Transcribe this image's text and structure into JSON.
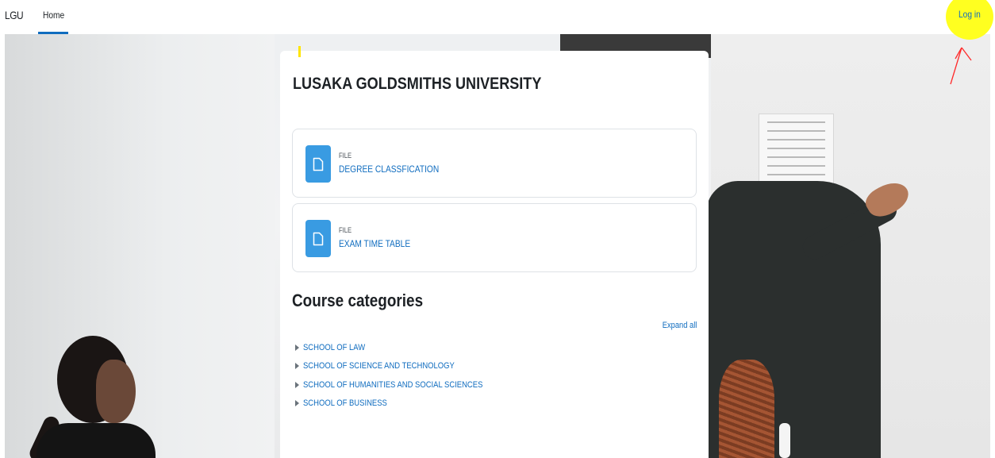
{
  "navbar": {
    "brand": "LGU",
    "home_label": "Home",
    "login_label": "Log in"
  },
  "site": {
    "title": "LUSAKA GOLDSMITHS UNIVERSITY"
  },
  "activities": [
    {
      "type": "FILE",
      "name": "DEGREE CLASSFICATION",
      "icon": "file-icon"
    },
    {
      "type": "FILE",
      "name": "EXAM TIME TABLE",
      "icon": "file-icon"
    }
  ],
  "categories": {
    "heading": "Course categories",
    "expand_all": "Expand all",
    "items": [
      {
        "label": "SCHOOL OF LAW"
      },
      {
        "label": "SCHOOL OF SCIENCE AND TECHNOLOGY"
      },
      {
        "label": "SCHOOL OF HUMANITIES AND SOCIAL SCIENCES"
      },
      {
        "label": "SCHOOL OF BUSINESS"
      }
    ]
  },
  "colors": {
    "link": "#0f6cbf",
    "icon_bg": "#399be2",
    "highlight": "#ffff20",
    "annotation_arrow": "#ff2a2a"
  }
}
